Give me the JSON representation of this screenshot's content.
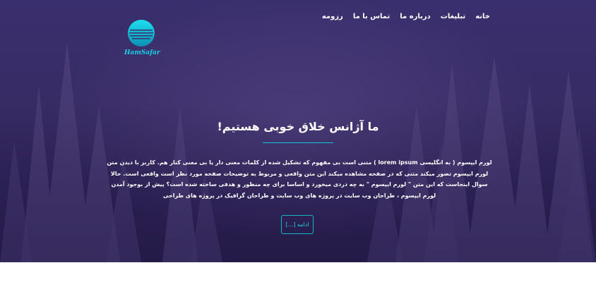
{
  "nav": {
    "items": [
      "خانه",
      "تبلیغات",
      "درباره ما",
      "تماس با ما",
      "رزومه"
    ]
  },
  "logo": {
    "text": "HamSafar"
  },
  "hero": {
    "headline": "ما آژانس خلاق خوبی هستیم!",
    "paragraph": "لورم ایپسوم ( به انگلیسی lorem ipsum ) متنی است بی مفهوم که تشکیل شده از کلمات معنی دار یا بی معنی کنار هم. کاربر با دیدن متن لورم ایپسوم تصور میکند متنی که در صفحه مشاهده میکند این متن واقعی و مربوط به توضیحات صفحه مورد نظر است واقعی است. حالا سوال اینجاست که این متن \" لورم ایپسوم \" به چه دردی میخورد و اساسا برای چه منظور و هدفی ساخته شده است؟ پیش از بوجود آمدن لورم ایپسوم ، طراحان وب سایت در پروژه های وب سایت و طراحان گرافیک در پروژه های طراحی",
    "button_label": "ادامه [...]"
  },
  "colors": {
    "hero_bg": "#3a2f6e",
    "accent": "#14b8c8",
    "logo": "#19d3e8"
  }
}
